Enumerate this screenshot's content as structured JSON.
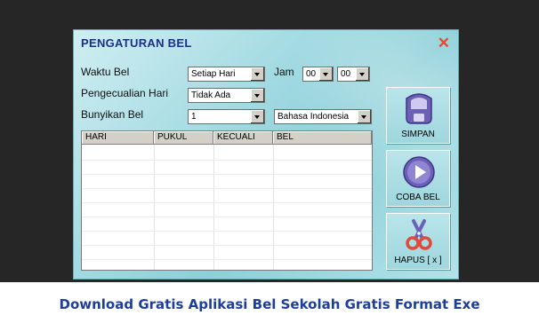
{
  "window": {
    "title": "PENGATURAN BEL",
    "close_glyph": "✕"
  },
  "form": {
    "waktu_label": "Waktu Bel",
    "waktu_value": "Setiap Hari",
    "jam_label": "Jam",
    "jam_hour": "00",
    "jam_minute": "00",
    "pengecualian_label": "Pengecualian Hari",
    "pengecualian_value": "Tidak Ada",
    "bunyikan_label": "Bunyikan Bel",
    "bunyikan_value": "1",
    "bahasa_value": "Bahasa Indonesia"
  },
  "table": {
    "columns": [
      "HARI",
      "PUKUL",
      "KECUALI",
      "BEL"
    ],
    "rows": []
  },
  "buttons": {
    "simpan": "SIMPAN",
    "coba": "COBA BEL",
    "hapus": "HAPUS [ x ]"
  },
  "caption": "Download Gratis Aplikasi Bel Sekolah Gratis Format Exe",
  "colors": {
    "title": "#1a2f8a",
    "close": "#e34a2f",
    "caption": "#1d3f9a",
    "icon_purple": "#6b5fb8"
  }
}
